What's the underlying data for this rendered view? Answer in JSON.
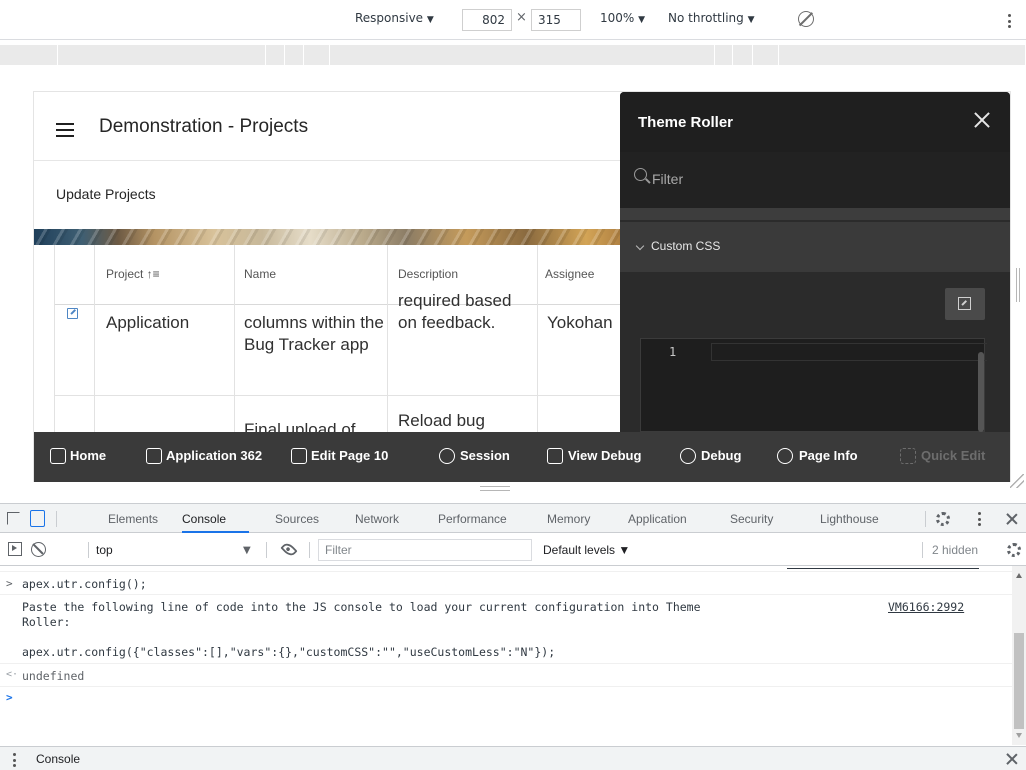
{
  "device_toolbar": {
    "device": "Responsive",
    "width": "802",
    "times": "×",
    "height": "315",
    "zoom": "100%",
    "throttling": "No throttling",
    "dropdown_arrow": "▼"
  },
  "page": {
    "title": "Demonstration - Projects",
    "region_title": "Update Projects",
    "columns": [
      "Project ↑≡",
      "Name",
      "Description",
      "Assignee"
    ],
    "rows": [
      {
        "project": "Application",
        "name": "columns within the Bug Tracker app",
        "description": "required based on feedback.",
        "assignee": "Yokohan"
      },
      {
        "project": "",
        "name": "Final upload of",
        "description": "Reload bug",
        "assignee": ""
      }
    ]
  },
  "theme_roller": {
    "title": "Theme Roller",
    "filter_placeholder": "Filter",
    "section_label": "Custom CSS",
    "line_number": "1"
  },
  "dev_toolbar": {
    "items": [
      {
        "label": "Home",
        "icon": "home-icon"
      },
      {
        "label": "Application 362",
        "icon": "edit-icon"
      },
      {
        "label": "Edit Page 10",
        "icon": "edit-page-icon"
      },
      {
        "label": "Session",
        "icon": "session-icon"
      },
      {
        "label": "View Debug",
        "icon": "view-debug-icon"
      },
      {
        "label": "Debug",
        "icon": "bug-icon"
      },
      {
        "label": "Page Info",
        "icon": "info-icon"
      },
      {
        "label": "Quick Edit",
        "icon": "quick-edit-icon"
      }
    ]
  },
  "devtools": {
    "tabs": [
      "Elements",
      "Console",
      "Sources",
      "Network",
      "Performance",
      "Memory",
      "Application",
      "Security",
      "Lighthouse"
    ],
    "active_tab": "Console",
    "context": "top",
    "filter_placeholder": "Filter",
    "levels": "Default levels ▼",
    "hidden_count": "2 hidden",
    "console": {
      "command": "apex.utr.config();",
      "message_line1": "Paste the following line of code into the JS console to load your current configuration into Theme",
      "message_line2": "Roller:",
      "source_link": "VM6166:2992",
      "code_line": "apex.utr.config({\"classes\":[],\"vars\":{},\"customCSS\":\"\",\"useCustomLess\":\"N\"});",
      "result": "undefined",
      "input_prompt": ">",
      "result_prompt": "<·",
      "command_prompt": ">"
    },
    "drawer_label": "Console"
  },
  "colors": {
    "accent": "#1a73e8",
    "theme_roller_bg": "#2b2b2b",
    "dev_toolbar_bg": "#3a3a3a"
  }
}
